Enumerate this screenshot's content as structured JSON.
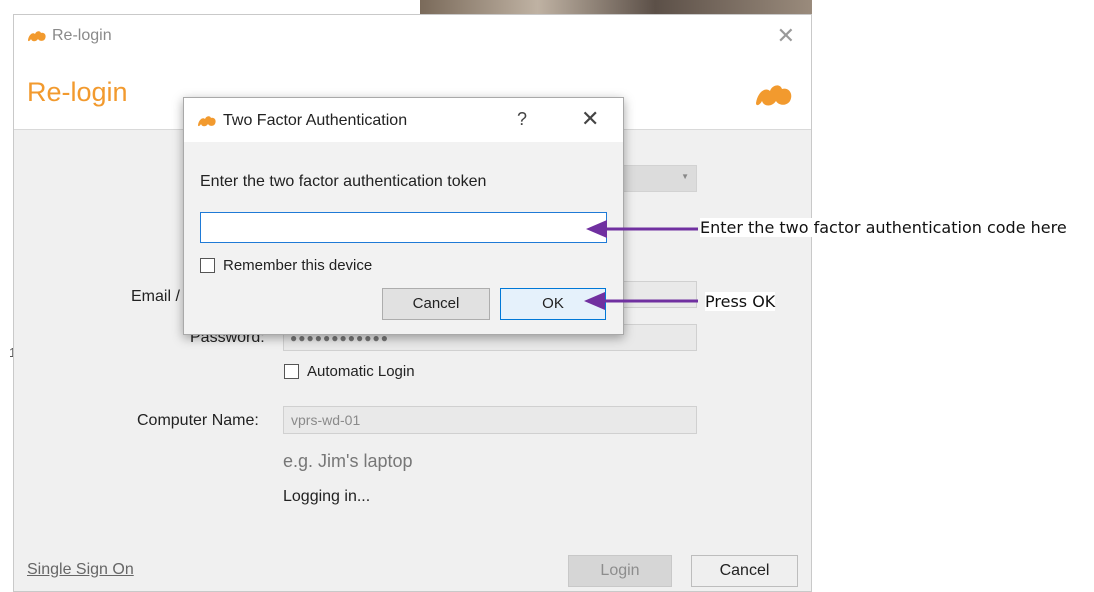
{
  "main_window": {
    "title": "Re-login",
    "header_title": "Re-login",
    "email_label": "Email /",
    "password_label": "Password:",
    "password_mask": "●●●●●●●●●●●●",
    "automatic_login_label": "Automatic Login",
    "computer_name_label": "Computer Name:",
    "computer_name_value": "vprs-wd-01",
    "computer_name_hint": "e.g. Jim's laptop",
    "status": "Logging in...",
    "single_sign_on": "Single Sign On",
    "login_button": "Login",
    "cancel_button": "Cancel",
    "close_glyph": "✕"
  },
  "dialog": {
    "title": "Two Factor Authentication",
    "help_glyph": "?",
    "close_glyph": "✕",
    "prompt": "Enter the two factor authentication token",
    "token_value": "",
    "remember_label": "Remember this device",
    "cancel_button": "Cancel",
    "ok_button": "OK"
  },
  "annotations": {
    "token_note": "Enter the two factor authentication code here",
    "ok_note": "Press OK"
  },
  "colors": {
    "accent_orange": "#f29a2e",
    "annotation_purple": "#7030a0",
    "focus_blue": "#1f7ad6"
  },
  "icons": {
    "app_logo": "seafile-logo-icon"
  }
}
